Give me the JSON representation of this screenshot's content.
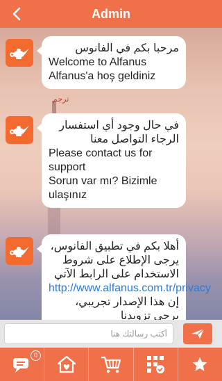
{
  "header": {
    "title": "Admin"
  },
  "background": {
    "overlay_label": "ترجم"
  },
  "messages": [
    {
      "lines": [
        {
          "text": "مرحبا بكم في الفانوس",
          "dir": "rtl"
        },
        {
          "text": "Welcome to Alfanus",
          "dir": "ltr"
        },
        {
          "text": "Alfanus'a hoş geldiniz",
          "dir": "ltr"
        }
      ]
    },
    {
      "lines": [
        {
          "text": "في حال وجود أي استفسار الرجاء التواصل معنا",
          "dir": "rtl"
        },
        {
          "text": "Please contact us for support",
          "dir": "ltr"
        },
        {
          "text": "Sorun var mı? Bizimle ulaşınız",
          "dir": "ltr"
        }
      ]
    },
    {
      "lines": [
        {
          "text": "أهلا بكم في تطبيق الفانوس، يرجى الإطلاع على شروط الاستخدام على الرابط الآتي",
          "dir": "rtl"
        }
      ],
      "link": "http://www.alfanus.com.tr/privacy",
      "link_tail": "إن هذا الإصدار تجريبي، يرجى تزويدنا"
    }
  ],
  "composer": {
    "placeholder": "أكتب رسالتك هنا"
  },
  "tabbar": {
    "chat_badge": "0"
  },
  "colors": {
    "primary": "#f0704a",
    "avatar": "#f26a2e",
    "link": "#2a7bd8"
  }
}
